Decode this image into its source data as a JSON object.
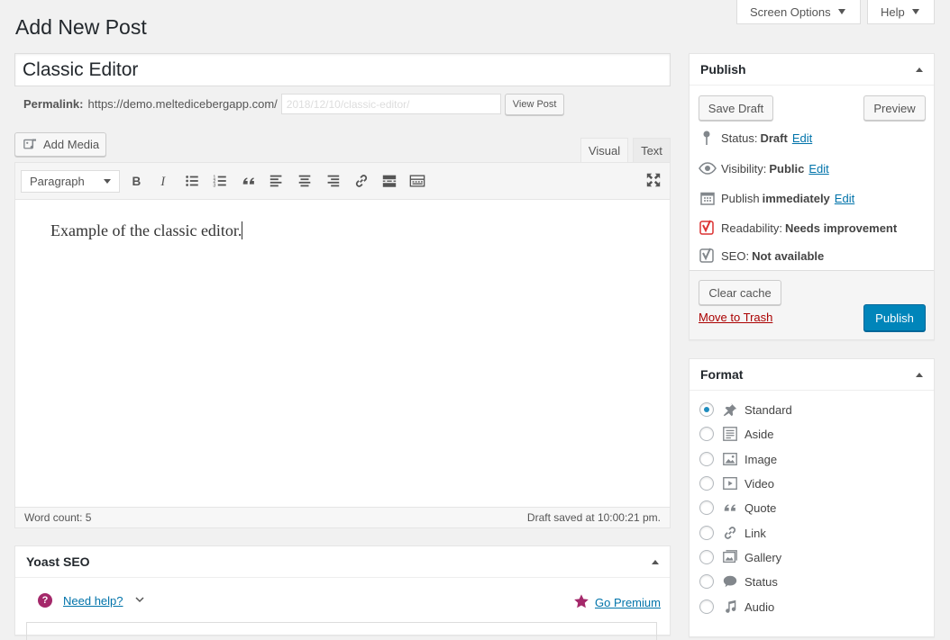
{
  "header": {
    "title": "Add New Post",
    "screen_options": "Screen Options",
    "help": "Help"
  },
  "post": {
    "title": "Classic Editor",
    "permalink_label": "Permalink:",
    "permalink_base": "https://demo.meltedicebergapp.com/",
    "slug": "2018/12/10/classic-editor/",
    "view_post": "View Post"
  },
  "editor": {
    "add_media": "Add Media",
    "tab_visual": "Visual",
    "tab_text": "Text",
    "format_select": "Paragraph",
    "content": "Example of the classic editor.",
    "word_count": "Word count: 5",
    "draft_saved": "Draft saved at 10:00:21 pm."
  },
  "publish": {
    "title": "Publish",
    "save_draft": "Save Draft",
    "preview": "Preview",
    "status_label": "Status:",
    "status_value": "Draft",
    "visibility_label": "Visibility:",
    "visibility_value": "Public",
    "publish_label": "Publish",
    "publish_value": "immediately",
    "edit": "Edit",
    "readability_label": "Readability:",
    "readability_value": "Needs improvement",
    "seo_label": "SEO:",
    "seo_value": "Not available",
    "clear_cache": "Clear cache",
    "move_to_trash": "Move to Trash",
    "publish_button": "Publish"
  },
  "format": {
    "title": "Format",
    "options": [
      "Standard",
      "Aside",
      "Image",
      "Video",
      "Quote",
      "Link",
      "Gallery",
      "Status",
      "Audio"
    ],
    "selected": "Standard"
  },
  "yoast": {
    "title": "Yoast SEO",
    "need_help": "Need help?",
    "go_premium": "Go Premium"
  },
  "colors": {
    "accent": "#0073aa",
    "primary_button": "#0085ba",
    "trash": "#a00",
    "yoast_red": "#dc3232",
    "premium": "#a4286a"
  }
}
